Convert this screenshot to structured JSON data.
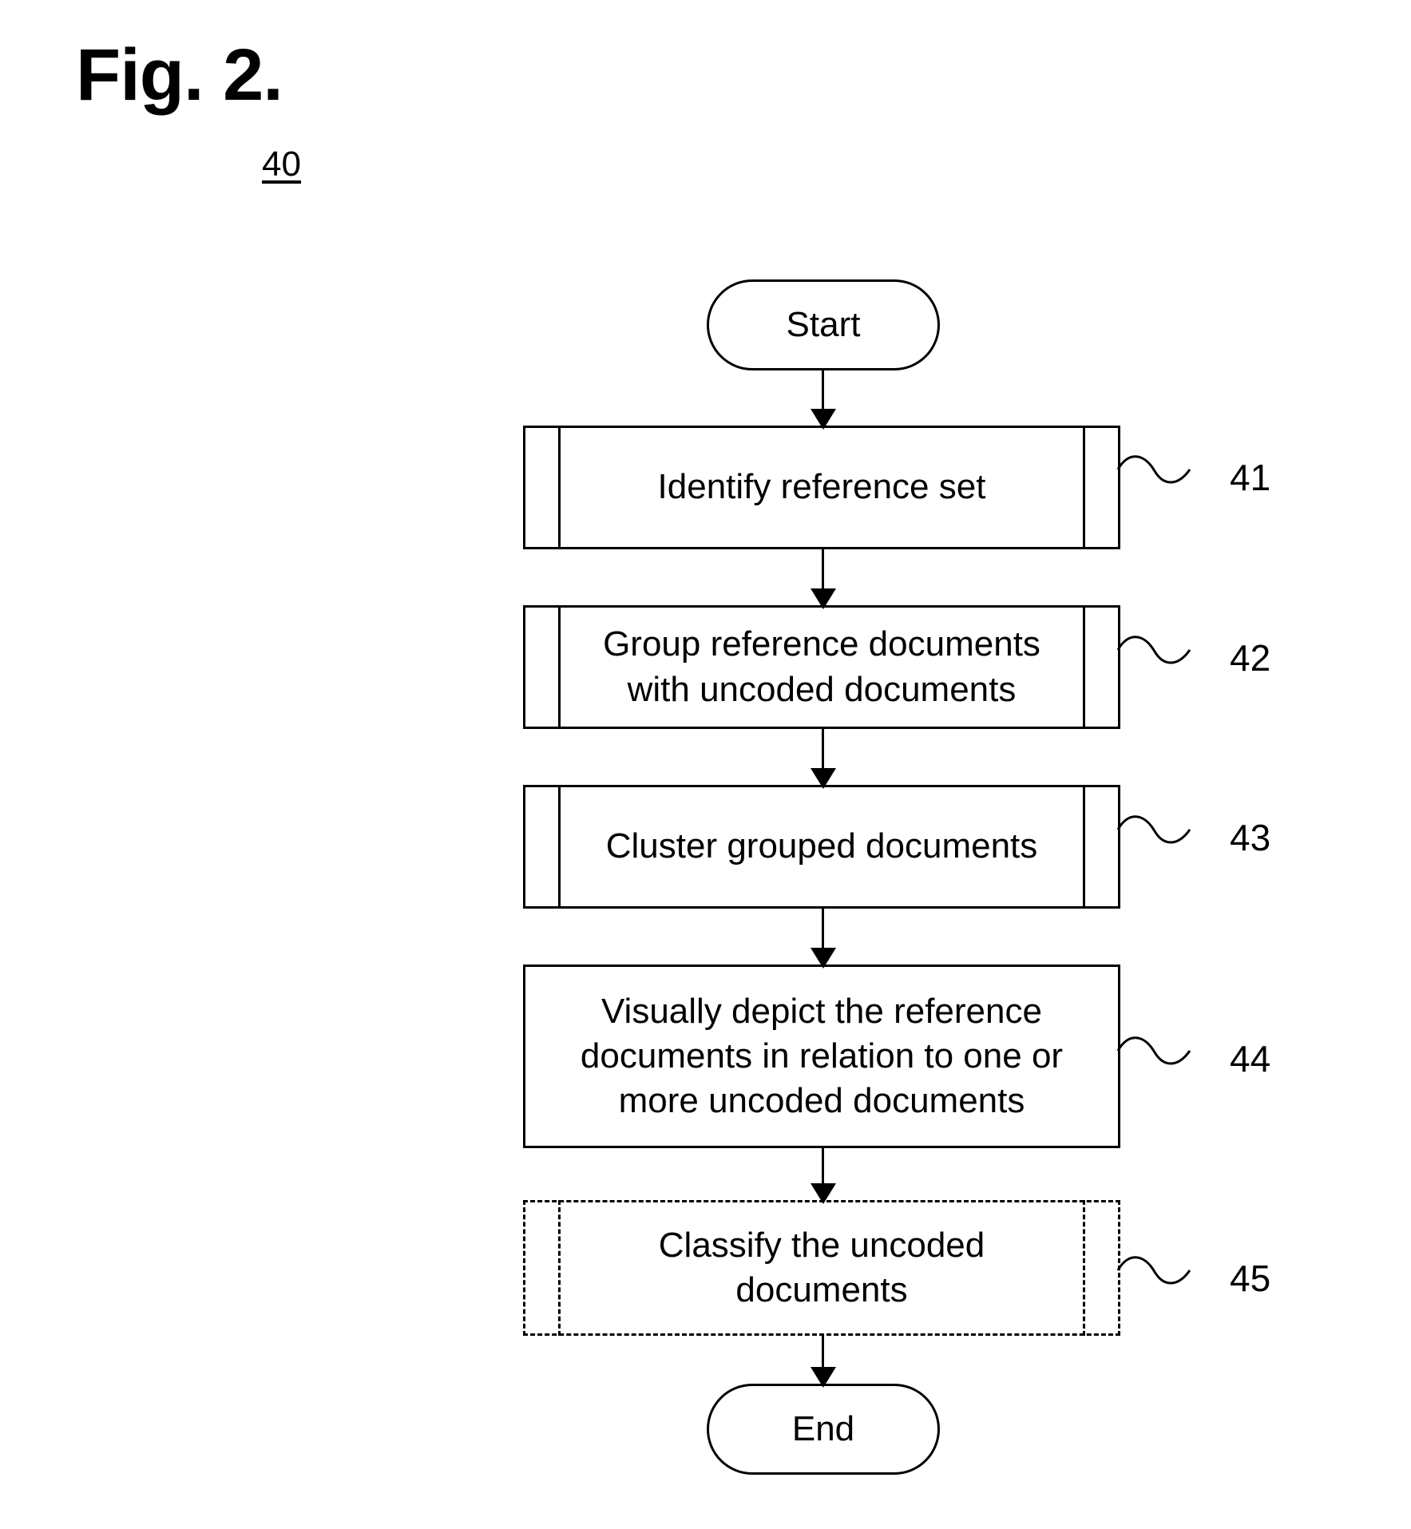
{
  "figure": {
    "title": "Fig. 2.",
    "figure_reference": "40"
  },
  "flowchart": {
    "nodes": [
      {
        "id": "start",
        "shape": "terminator",
        "label": "Start"
      },
      {
        "id": "41",
        "shape": "predefined-process",
        "label": "Identify reference set",
        "ref": "41"
      },
      {
        "id": "42",
        "shape": "predefined-process",
        "label": "Group reference documents\nwith uncoded documents",
        "ref": "42"
      },
      {
        "id": "43",
        "shape": "predefined-process",
        "label": "Cluster grouped documents",
        "ref": "43"
      },
      {
        "id": "44",
        "shape": "process",
        "label": "Visually depict the reference\ndocuments in relation to one or\nmore uncoded documents",
        "ref": "44"
      },
      {
        "id": "45",
        "shape": "predefined-process-dashed",
        "label": "Classify the uncoded\ndocuments",
        "ref": "45"
      },
      {
        "id": "end",
        "shape": "terminator",
        "label": "End"
      }
    ],
    "edges": [
      {
        "from": "start",
        "to": "41"
      },
      {
        "from": "41",
        "to": "42"
      },
      {
        "from": "42",
        "to": "43"
      },
      {
        "from": "43",
        "to": "44"
      },
      {
        "from": "44",
        "to": "45"
      },
      {
        "from": "45",
        "to": "end"
      }
    ]
  },
  "colors": {
    "line": "#000000",
    "background": "#ffffff"
  }
}
